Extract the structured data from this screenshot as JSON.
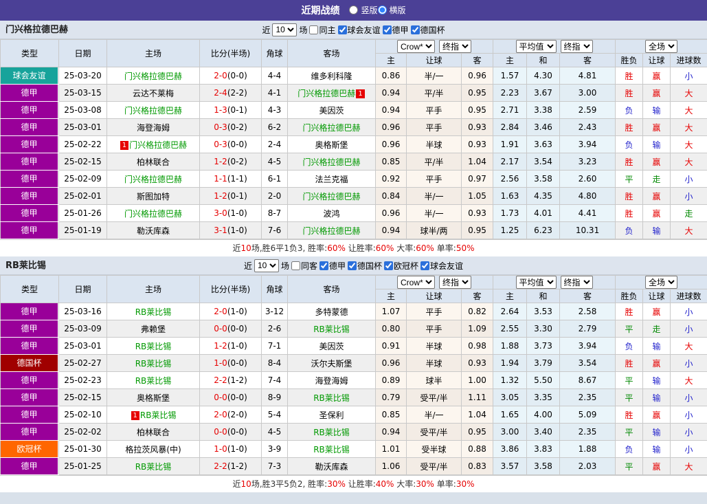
{
  "header": {
    "title": "近期战绩",
    "radios": [
      {
        "label": "竖版",
        "selected": false
      },
      {
        "label": "横版",
        "selected": true
      }
    ]
  },
  "table": {
    "left_columns": [
      "类型",
      "日期",
      "主场",
      "比分(半场)",
      "角球",
      "客场"
    ],
    "group1_selects": [
      "Crow*",
      "终指"
    ],
    "group2_selects": [
      "平均值",
      "终指"
    ],
    "group3_select": "全场",
    "sub_columns_1": [
      "主",
      "让球",
      "客"
    ],
    "sub_columns_2": [
      "主",
      "和",
      "客"
    ],
    "sub_columns_3": [
      "胜负",
      "让球",
      "进球数"
    ]
  },
  "colors": {
    "accent_bar": "#4b4096",
    "focus_team": "#009900",
    "score_main": "#e60000",
    "summary_red": "#e60000",
    "league": {
      "德甲": "#990099",
      "德国杯": "#a00000",
      "欧冠杯": "#ff6600",
      "球会友谊": "#17a39b"
    },
    "result": {
      "胜": "#e60000",
      "赢": "#e60000",
      "大": "#e60000",
      "平": "#008800",
      "走": "#008800",
      "负": "#2222cc",
      "输": "#2222cc",
      "小": "#2222cc"
    }
  },
  "sections": [
    {
      "team": "门兴格拉德巴赫",
      "filters": {
        "near_label": "近",
        "count": "10",
        "games_label": "场",
        "same_venue": {
          "label": "同主",
          "checked": false
        },
        "leagues": [
          {
            "label": "球会友谊",
            "checked": true
          },
          {
            "label": "德甲",
            "checked": true
          },
          {
            "label": "德国杯",
            "checked": true
          }
        ]
      },
      "rows": [
        {
          "league": "球会友谊",
          "date": "25-03-20",
          "home": "门兴格拉德巴赫",
          "home_focus": true,
          "score": "2-0",
          "half": "(0-0)",
          "corner": "4-4",
          "away": "维多利科隆",
          "away_focus": false,
          "odds": [
            "0.86",
            "半/一",
            "0.96"
          ],
          "avg": [
            "1.57",
            "4.30",
            "4.81"
          ],
          "res": [
            "胜",
            "赢",
            "小"
          ]
        },
        {
          "league": "德甲",
          "date": "25-03-15",
          "home": "云达不莱梅",
          "home_focus": false,
          "score": "2-4",
          "half": "(2-2)",
          "corner": "4-1",
          "away": "门兴格拉德巴赫",
          "away_focus": true,
          "away_badge": "1",
          "away_badge_pos": "suffix",
          "odds": [
            "0.94",
            "平/半",
            "0.95"
          ],
          "avg": [
            "2.23",
            "3.67",
            "3.00"
          ],
          "res": [
            "胜",
            "赢",
            "大"
          ]
        },
        {
          "league": "德甲",
          "date": "25-03-08",
          "home": "门兴格拉德巴赫",
          "home_focus": true,
          "score": "1-3",
          "half": "(0-1)",
          "corner": "4-3",
          "away": "美因茨",
          "away_focus": false,
          "odds": [
            "0.94",
            "平手",
            "0.95"
          ],
          "avg": [
            "2.71",
            "3.38",
            "2.59"
          ],
          "res": [
            "负",
            "输",
            "大"
          ]
        },
        {
          "league": "德甲",
          "date": "25-03-01",
          "home": "海登海姆",
          "home_focus": false,
          "score": "0-3",
          "half": "(0-2)",
          "corner": "6-2",
          "away": "门兴格拉德巴赫",
          "away_focus": true,
          "odds": [
            "0.96",
            "平手",
            "0.93"
          ],
          "avg": [
            "2.84",
            "3.46",
            "2.43"
          ],
          "res": [
            "胜",
            "赢",
            "大"
          ]
        },
        {
          "league": "德甲",
          "date": "25-02-22",
          "home": "门兴格拉德巴赫",
          "home_focus": true,
          "home_badge": "1",
          "home_badge_pos": "prefix",
          "score": "0-3",
          "half": "(0-0)",
          "corner": "2-4",
          "away": "奥格斯堡",
          "away_focus": false,
          "odds": [
            "0.96",
            "半球",
            "0.93"
          ],
          "avg": [
            "1.91",
            "3.63",
            "3.94"
          ],
          "res": [
            "负",
            "输",
            "大"
          ]
        },
        {
          "league": "德甲",
          "date": "25-02-15",
          "home": "柏林联合",
          "home_focus": false,
          "score": "1-2",
          "half": "(0-2)",
          "corner": "4-5",
          "away": "门兴格拉德巴赫",
          "away_focus": true,
          "odds": [
            "0.85",
            "平/半",
            "1.04"
          ],
          "avg": [
            "2.17",
            "3.54",
            "3.23"
          ],
          "res": [
            "胜",
            "赢",
            "大"
          ]
        },
        {
          "league": "德甲",
          "date": "25-02-09",
          "home": "门兴格拉德巴赫",
          "home_focus": true,
          "score": "1-1",
          "half": "(1-1)",
          "corner": "6-1",
          "away": "法兰克福",
          "away_focus": false,
          "odds": [
            "0.92",
            "平手",
            "0.97"
          ],
          "avg": [
            "2.56",
            "3.58",
            "2.60"
          ],
          "res": [
            "平",
            "走",
            "小"
          ]
        },
        {
          "league": "德甲",
          "date": "25-02-01",
          "home": "斯图加特",
          "home_focus": false,
          "score": "1-2",
          "half": "(0-1)",
          "corner": "2-0",
          "away": "门兴格拉德巴赫",
          "away_focus": true,
          "odds": [
            "0.84",
            "半/一",
            "1.05"
          ],
          "avg": [
            "1.63",
            "4.35",
            "4.80"
          ],
          "res": [
            "胜",
            "赢",
            "小"
          ]
        },
        {
          "league": "德甲",
          "date": "25-01-26",
          "home": "门兴格拉德巴赫",
          "home_focus": true,
          "score": "3-0",
          "half": "(1-0)",
          "corner": "8-7",
          "away": "波鸿",
          "away_focus": false,
          "odds": [
            "0.96",
            "半/一",
            "0.93"
          ],
          "avg": [
            "1.73",
            "4.01",
            "4.41"
          ],
          "res": [
            "胜",
            "赢",
            "走"
          ]
        },
        {
          "league": "德甲",
          "date": "25-01-19",
          "home": "勒沃库森",
          "home_focus": false,
          "score": "3-1",
          "half": "(1-0)",
          "corner": "7-6",
          "away": "门兴格拉德巴赫",
          "away_focus": true,
          "odds": [
            "0.94",
            "球半/两",
            "0.95"
          ],
          "avg": [
            "1.25",
            "6.23",
            "10.31"
          ],
          "res": [
            "负",
            "输",
            "大"
          ]
        }
      ],
      "summary": [
        [
          "近",
          "b"
        ],
        [
          "10",
          "r"
        ],
        [
          "场,胜6平1负3, 胜率:",
          "b"
        ],
        [
          "60%",
          "r"
        ],
        [
          " 让胜率:",
          "b"
        ],
        [
          "60%",
          "r"
        ],
        [
          " 大率:",
          "b"
        ],
        [
          "60%",
          "r"
        ],
        [
          " 单率:",
          "b"
        ],
        [
          "50%",
          "r"
        ]
      ]
    },
    {
      "team": "RB莱比锡",
      "filters": {
        "near_label": "近",
        "count": "10",
        "games_label": "场",
        "same_venue": {
          "label": "同客",
          "checked": false
        },
        "leagues": [
          {
            "label": "德甲",
            "checked": true
          },
          {
            "label": "德国杯",
            "checked": true
          },
          {
            "label": "欧冠杯",
            "checked": true
          },
          {
            "label": "球会友谊",
            "checked": true
          }
        ]
      },
      "rows": [
        {
          "league": "德甲",
          "date": "25-03-16",
          "home": "RB莱比锡",
          "home_focus": true,
          "score": "2-0",
          "half": "(1-0)",
          "corner": "3-12",
          "away": "多特蒙德",
          "away_focus": false,
          "odds": [
            "1.07",
            "平手",
            "0.82"
          ],
          "avg": [
            "2.64",
            "3.53",
            "2.58"
          ],
          "res": [
            "胜",
            "赢",
            "小"
          ]
        },
        {
          "league": "德甲",
          "date": "25-03-09",
          "home": "弗赖堡",
          "home_focus": false,
          "score": "0-0",
          "half": "(0-0)",
          "corner": "2-6",
          "away": "RB莱比锡",
          "away_focus": true,
          "odds": [
            "0.80",
            "平手",
            "1.09"
          ],
          "avg": [
            "2.55",
            "3.30",
            "2.79"
          ],
          "res": [
            "平",
            "走",
            "小"
          ]
        },
        {
          "league": "德甲",
          "date": "25-03-01",
          "home": "RB莱比锡",
          "home_focus": true,
          "score": "1-2",
          "half": "(1-0)",
          "corner": "7-1",
          "away": "美因茨",
          "away_focus": false,
          "odds": [
            "0.91",
            "半球",
            "0.98"
          ],
          "avg": [
            "1.88",
            "3.73",
            "3.94"
          ],
          "res": [
            "负",
            "输",
            "大"
          ]
        },
        {
          "league": "德国杯",
          "date": "25-02-27",
          "home": "RB莱比锡",
          "home_focus": true,
          "score": "1-0",
          "half": "(0-0)",
          "corner": "8-4",
          "away": "沃尔夫斯堡",
          "away_focus": false,
          "odds": [
            "0.96",
            "半球",
            "0.93"
          ],
          "avg": [
            "1.94",
            "3.79",
            "3.54"
          ],
          "res": [
            "胜",
            "赢",
            "小"
          ]
        },
        {
          "league": "德甲",
          "date": "25-02-23",
          "home": "RB莱比锡",
          "home_focus": true,
          "score": "2-2",
          "half": "(1-2)",
          "corner": "7-4",
          "away": "海登海姆",
          "away_focus": false,
          "odds": [
            "0.89",
            "球半",
            "1.00"
          ],
          "avg": [
            "1.32",
            "5.50",
            "8.67"
          ],
          "res": [
            "平",
            "输",
            "大"
          ]
        },
        {
          "league": "德甲",
          "date": "25-02-15",
          "home": "奥格斯堡",
          "home_focus": false,
          "score": "0-0",
          "half": "(0-0)",
          "corner": "8-9",
          "away": "RB莱比锡",
          "away_focus": true,
          "odds": [
            "0.79",
            "受平/半",
            "1.11"
          ],
          "avg": [
            "3.05",
            "3.35",
            "2.35"
          ],
          "res": [
            "平",
            "输",
            "小"
          ]
        },
        {
          "league": "德甲",
          "date": "25-02-10",
          "home": "RB莱比锡",
          "home_focus": true,
          "home_badge": "1",
          "home_badge_pos": "prefix",
          "score": "2-0",
          "half": "(2-0)",
          "corner": "5-4",
          "away": "圣保利",
          "away_focus": false,
          "odds": [
            "0.85",
            "半/一",
            "1.04"
          ],
          "avg": [
            "1.65",
            "4.00",
            "5.09"
          ],
          "res": [
            "胜",
            "赢",
            "小"
          ]
        },
        {
          "league": "德甲",
          "date": "25-02-02",
          "home": "柏林联合",
          "home_focus": false,
          "score": "0-0",
          "half": "(0-0)",
          "corner": "4-5",
          "away": "RB莱比锡",
          "away_focus": true,
          "odds": [
            "0.94",
            "受平/半",
            "0.95"
          ],
          "avg": [
            "3.00",
            "3.40",
            "2.35"
          ],
          "res": [
            "平",
            "输",
            "小"
          ]
        },
        {
          "league": "欧冠杯",
          "date": "25-01-30",
          "home": "格拉茨风暴(中)",
          "home_focus": false,
          "score": "1-0",
          "half": "(1-0)",
          "corner": "3-9",
          "away": "RB莱比锡",
          "away_focus": true,
          "odds": [
            "1.01",
            "受半球",
            "0.88"
          ],
          "avg": [
            "3.86",
            "3.83",
            "1.88"
          ],
          "res": [
            "负",
            "输",
            "小"
          ]
        },
        {
          "league": "德甲",
          "date": "25-01-25",
          "home": "RB莱比锡",
          "home_focus": true,
          "score": "2-2",
          "half": "(1-2)",
          "corner": "7-3",
          "away": "勒沃库森",
          "away_focus": false,
          "odds": [
            "1.06",
            "受平/半",
            "0.83"
          ],
          "avg": [
            "3.57",
            "3.58",
            "2.03"
          ],
          "res": [
            "平",
            "赢",
            "大"
          ]
        }
      ],
      "summary": [
        [
          "近",
          "b"
        ],
        [
          "10",
          "r"
        ],
        [
          "场,胜3平5负2, 胜率:",
          "b"
        ],
        [
          "30%",
          "r"
        ],
        [
          " 让胜率:",
          "b"
        ],
        [
          "40%",
          "r"
        ],
        [
          " 大率:",
          "b"
        ],
        [
          "30%",
          "r"
        ],
        [
          " 单率:",
          "b"
        ],
        [
          "30%",
          "r"
        ]
      ]
    }
  ]
}
